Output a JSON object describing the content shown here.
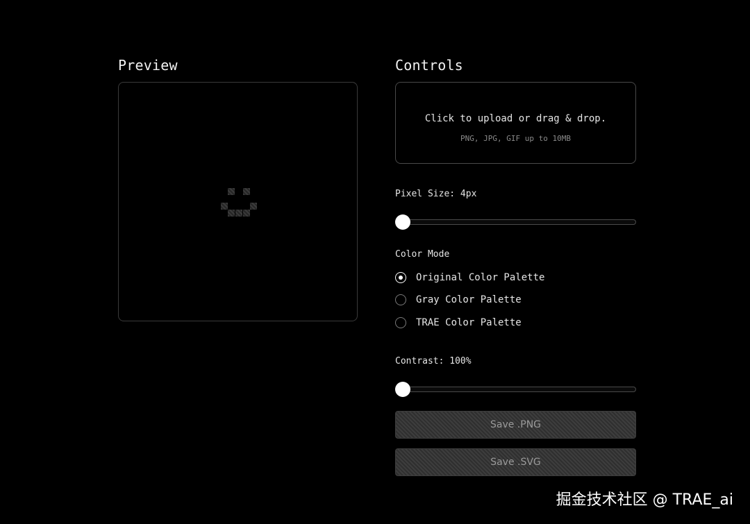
{
  "preview": {
    "title": "Preview",
    "placeholder_icon": "pixel-smiley-icon"
  },
  "controls": {
    "title": "Controls",
    "upload": {
      "main_text": "Click to upload or drag & drop.",
      "sub_text": "PNG, JPG, GIF up to 10MB"
    },
    "pixel_size": {
      "label": "Pixel Size: 4px",
      "value": 4
    },
    "color_mode": {
      "label": "Color Mode",
      "options": [
        {
          "label": "Original Color Palette",
          "selected": true
        },
        {
          "label": "Gray Color Palette",
          "selected": false
        },
        {
          "label": "TRAE Color Palette",
          "selected": false
        }
      ]
    },
    "contrast": {
      "label": "Contrast: 100%",
      "value": 100
    },
    "buttons": {
      "save_png": "Save .PNG",
      "save_svg": "Save .SVG"
    }
  },
  "watermark": "掘金技术社区 @ TRAE_ai",
  "colors": {
    "background": "#000000",
    "border": "#3a3a3a",
    "text": "#e6e6e6",
    "muted_text": "#8a8a8a",
    "button_bg": "#333333",
    "thumb": "#ffffff"
  }
}
